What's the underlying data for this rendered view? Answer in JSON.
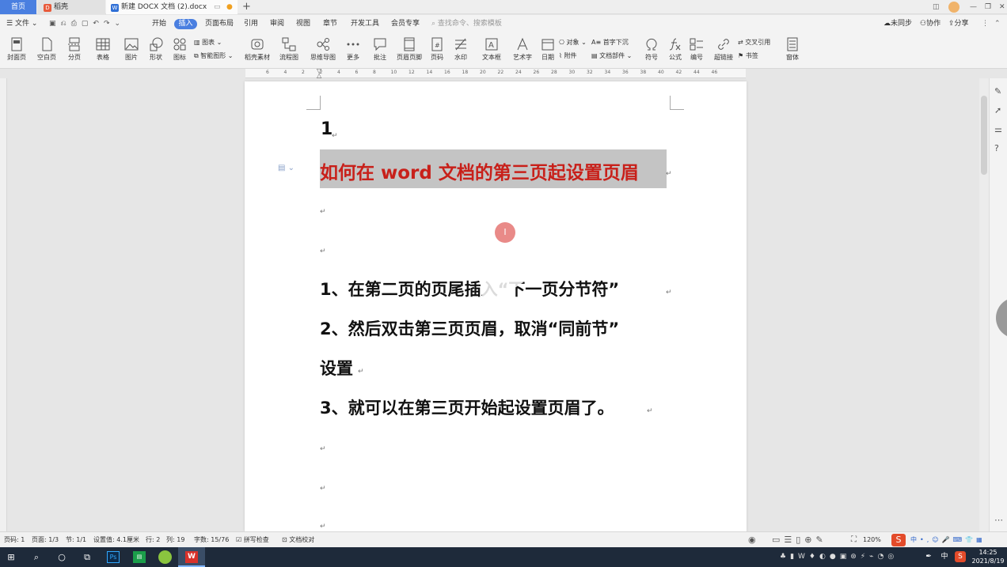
{
  "tabs": {
    "home": "首页",
    "daoke": "稻壳",
    "doc": "新建 DOCX 文档 (2).docx",
    "new_tab": "+"
  },
  "menubar": {
    "file": "文件",
    "items": [
      "开始",
      "插入",
      "页面布局",
      "引用",
      "审阅",
      "视图",
      "章节",
      "开发工具",
      "会员专享"
    ],
    "active": "插入",
    "search_placeholder": "查找命令、搜索模板",
    "sync": "未同步",
    "collab": "协作",
    "share": "分享"
  },
  "ribbon": {
    "tools": [
      {
        "label": "封面页",
        "icon": "cover-page-icon"
      },
      {
        "label": "空白页",
        "icon": "blank-page-icon"
      },
      {
        "label": "分页",
        "icon": "page-break-icon"
      },
      {
        "label": "表格",
        "icon": "table-icon"
      },
      {
        "label": "图片",
        "icon": "picture-icon"
      },
      {
        "label": "形状",
        "icon": "shape-icon"
      },
      {
        "label": "图标",
        "icon": "icons-icon"
      },
      {
        "label": "稻壳素材",
        "icon": "material-icon"
      },
      {
        "label": "流程图",
        "icon": "flowchart-icon"
      },
      {
        "label": "思维导图",
        "icon": "mindmap-icon"
      },
      {
        "label": "更多",
        "icon": "more-icon"
      },
      {
        "label": "批注",
        "icon": "comment-icon"
      },
      {
        "label": "页眉页脚",
        "icon": "header-footer-icon"
      },
      {
        "label": "页码",
        "icon": "page-number-icon"
      },
      {
        "label": "水印",
        "icon": "watermark-icon"
      },
      {
        "label": "文本框",
        "icon": "textbox-icon"
      },
      {
        "label": "艺术字",
        "icon": "wordart-icon"
      },
      {
        "label": "日期",
        "icon": "date-icon"
      },
      {
        "label": "符号",
        "icon": "symbol-icon"
      },
      {
        "label": "公式",
        "icon": "formula-icon"
      },
      {
        "label": "编号",
        "icon": "numbering-icon"
      },
      {
        "label": "超链接",
        "icon": "hyperlink-icon"
      },
      {
        "label": "窗体",
        "icon": "form-icon"
      }
    ],
    "small": {
      "chart": "图表",
      "smartart": "智能图形",
      "object": "对象",
      "attachment": "附件",
      "dropcap": "首字下沉",
      "docparts": "文档部件",
      "crossref": "交叉引用",
      "bookmark": "书签"
    }
  },
  "ruler_marks": [
    "6",
    "4",
    "2",
    "2",
    "4",
    "6",
    "8",
    "10",
    "12",
    "14",
    "16",
    "18",
    "20",
    "22",
    "24",
    "26",
    "28",
    "30",
    "32",
    "34",
    "36",
    "38",
    "40",
    "42",
    "44",
    "46"
  ],
  "document": {
    "heading_number": "1",
    "title": "如何在 word 文档的第三页起设置页眉",
    "steps": [
      "1、在第二页的页尾插入“下一页分节符”",
      "2、然后双击第三页页眉，取消“同前节”",
      "设置",
      "3、就可以在第三页开始起设置页眉了。"
    ],
    "return_mark": "↵",
    "cursor": "I"
  },
  "status": {
    "page_no": "页码: 1",
    "pages": "页面: 1/3",
    "section": "节: 1/1",
    "setting": "设置值: 4.1厘米",
    "row": "行: 2",
    "col": "列: 19",
    "words": "字数: 15/76",
    "spell": "拼写检查",
    "proof": "文档校对",
    "zoom": "120%"
  },
  "taskbar": {
    "time": "14:25",
    "date": "2021/8/19",
    "ime": "中"
  },
  "colors": {
    "title_red": "#c8201a",
    "accent_blue": "#4a7fe0",
    "selection": "#c4c4c4"
  }
}
